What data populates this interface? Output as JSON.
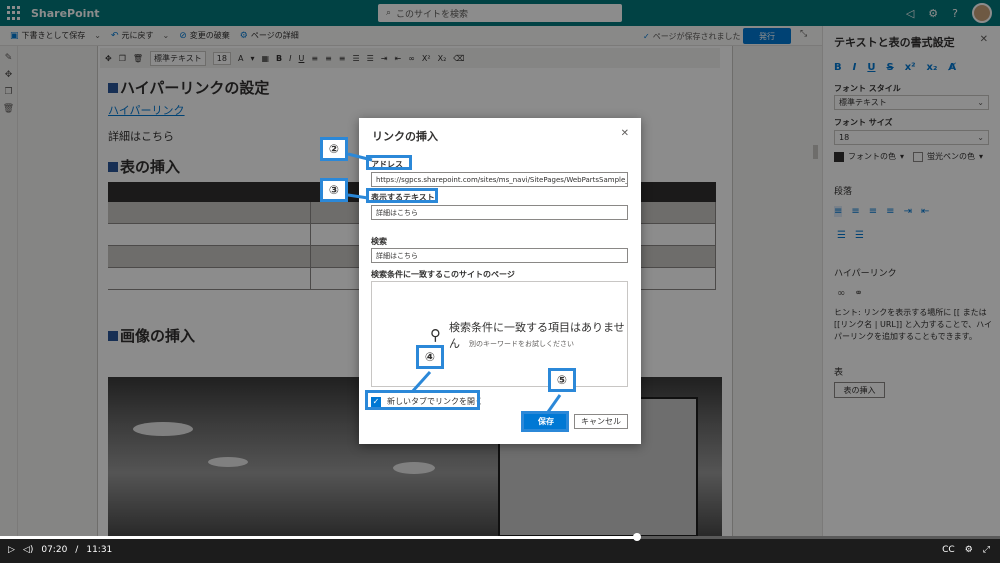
{
  "app": {
    "brand": "SharePoint",
    "search_placeholder": "このサイトを検索"
  },
  "commandbar": {
    "save_draft": "下書きとして保存",
    "undo": "元に戻す",
    "discard": "変更の破棄",
    "page_details": "ページの詳細",
    "saved_status": "ページが保存されました",
    "publish": "発行"
  },
  "format_toolbar": {
    "style": "標準テキスト",
    "size": "18"
  },
  "page": {
    "heading1": "ハイパーリンクの設定",
    "link_text": "ハイパーリンク",
    "para": "詳細はこちら",
    "heading2": "表の挿入",
    "heading3": "画像の挿入",
    "table_rows": 5
  },
  "right_panel": {
    "title": "テキストと表の書式設定",
    "font_style_label": "フォント スタイル",
    "font_style_value": "標準テキスト",
    "font_size_label": "フォント サイズ",
    "font_size_value": "18",
    "font_color": "フォントの色",
    "highlight_color": "蛍光ペンの色",
    "paragraph": "段落",
    "hyperlink": "ハイパーリンク",
    "hint": "ヒント: リンクを表示する場所に [[ または [[リンク名 | URL]] と入力することで、ハイパーリンクを追加することもできます。",
    "table": "表",
    "insert_table": "表の挿入"
  },
  "dialog": {
    "title": "リンクの挿入",
    "address_label": "アドレス",
    "address_value": "https://sgpcs.sharepoint.com/sites/ms_navi/SitePages/WebPartsSample_06...",
    "display_label": "表示するテキスト",
    "display_value": "詳細はこちら",
    "search_label": "検索",
    "search_value": "詳細はこちら",
    "results_label": "検索条件に一致するこのサイトのページ",
    "no_results": "検索条件に一致する項目はありません",
    "no_results_sub": "別のキーワードをお試しください",
    "new_tab_label": "新しいタブでリンクを開く",
    "new_tab_checked": true,
    "save": "保存",
    "cancel": "キャンセル"
  },
  "callouts": {
    "c2": "②",
    "c3": "③",
    "c4": "④",
    "c5": "⑤"
  },
  "player": {
    "current": "07:20",
    "separator": "/",
    "total": "11:31",
    "progress": 0.637
  },
  "colors": {
    "suite": "#03787c",
    "accent": "#0078d4",
    "callout": "#2b88d8"
  },
  "icons": [
    "waffle-icon",
    "search-icon",
    "megaphone-icon",
    "gear-icon",
    "help-icon",
    "play-icon",
    "volume-icon",
    "cc-icon",
    "settings-icon",
    "fullscreen-icon"
  ]
}
